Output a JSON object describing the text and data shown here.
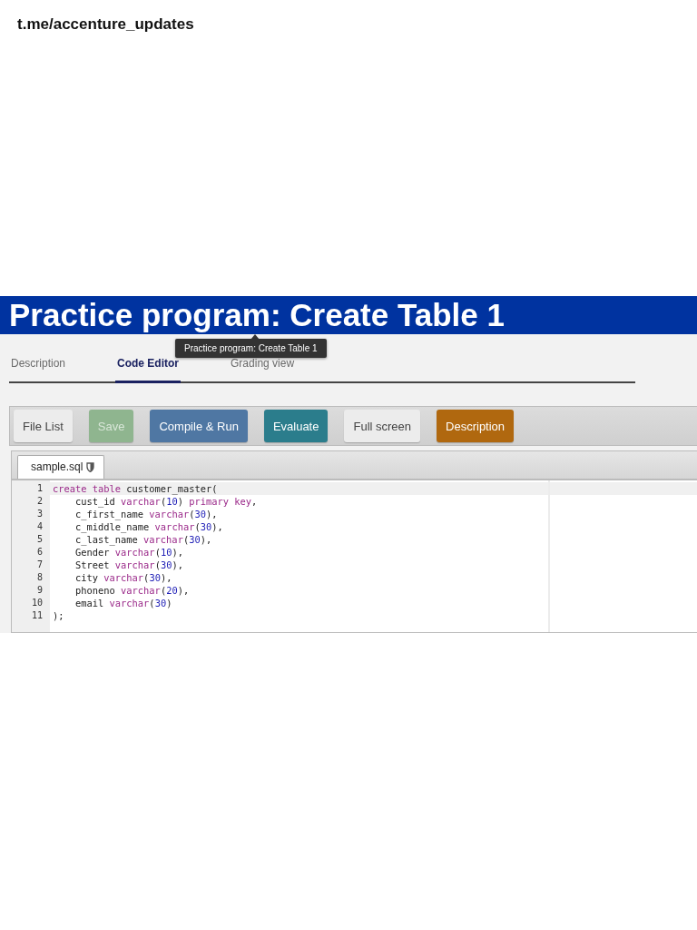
{
  "link": "t.me/accenture_updates",
  "title": "Practice program: Create Table 1",
  "tabs": [
    {
      "label": "Description",
      "selected": false
    },
    {
      "label": "Code Editor",
      "selected": true
    },
    {
      "label": "Grading view",
      "selected": false
    }
  ],
  "tooltip": "Practice program: Create Table 1",
  "toolbar": [
    {
      "label": "File List",
      "color": "#ececec",
      "disabled": false
    },
    {
      "label": "Save",
      "color": "#8fb58f",
      "disabled": true
    },
    {
      "label": "Compile & Run",
      "color": "#4f77a3",
      "disabled": false
    },
    {
      "label": "Evaluate",
      "color": "#2b7d8c",
      "disabled": false
    },
    {
      "label": "Full screen",
      "color": "#ececec",
      "disabled": false
    },
    {
      "label": "Description",
      "color": "#b0680f",
      "disabled": false
    }
  ],
  "file_tab": {
    "label": "sample.sql",
    "selected": true
  },
  "code": [
    {
      "number": "1",
      "active": true,
      "tokens": [
        {
          "kind": "keyword",
          "text": "create table"
        },
        {
          "kind": "plain",
          "text": " customer_master("
        }
      ]
    },
    {
      "number": "2",
      "active": false,
      "tokens": [
        {
          "kind": "plain",
          "text": "    cust_id "
        },
        {
          "kind": "keyword",
          "text": "varchar"
        },
        {
          "kind": "plain",
          "text": "("
        },
        {
          "kind": "number",
          "text": "10"
        },
        {
          "kind": "plain",
          "text": ") "
        },
        {
          "kind": "keyword",
          "text": "primary key"
        },
        {
          "kind": "plain",
          "text": ","
        }
      ]
    },
    {
      "number": "3",
      "active": false,
      "tokens": [
        {
          "kind": "plain",
          "text": "    c_first_name "
        },
        {
          "kind": "keyword",
          "text": "varchar"
        },
        {
          "kind": "plain",
          "text": "("
        },
        {
          "kind": "number",
          "text": "30"
        },
        {
          "kind": "plain",
          "text": "),"
        }
      ]
    },
    {
      "number": "4",
      "active": false,
      "tokens": [
        {
          "kind": "plain",
          "text": "    c_middle_name "
        },
        {
          "kind": "keyword",
          "text": "varchar"
        },
        {
          "kind": "plain",
          "text": "("
        },
        {
          "kind": "number",
          "text": "30"
        },
        {
          "kind": "plain",
          "text": "),"
        }
      ]
    },
    {
      "number": "5",
      "active": false,
      "tokens": [
        {
          "kind": "plain",
          "text": "    c_last_name "
        },
        {
          "kind": "keyword",
          "text": "varchar"
        },
        {
          "kind": "plain",
          "text": "("
        },
        {
          "kind": "number",
          "text": "30"
        },
        {
          "kind": "plain",
          "text": "),"
        }
      ]
    },
    {
      "number": "6",
      "active": false,
      "tokens": [
        {
          "kind": "plain",
          "text": "    Gender "
        },
        {
          "kind": "keyword",
          "text": "varchar"
        },
        {
          "kind": "plain",
          "text": "("
        },
        {
          "kind": "number",
          "text": "10"
        },
        {
          "kind": "plain",
          "text": "),"
        }
      ]
    },
    {
      "number": "7",
      "active": false,
      "tokens": [
        {
          "kind": "plain",
          "text": "    Street "
        },
        {
          "kind": "keyword",
          "text": "varchar"
        },
        {
          "kind": "plain",
          "text": "("
        },
        {
          "kind": "number",
          "text": "30"
        },
        {
          "kind": "plain",
          "text": "),"
        }
      ]
    },
    {
      "number": "8",
      "active": false,
      "tokens": [
        {
          "kind": "plain",
          "text": "    city "
        },
        {
          "kind": "keyword",
          "text": "varchar"
        },
        {
          "kind": "plain",
          "text": "("
        },
        {
          "kind": "number",
          "text": "30"
        },
        {
          "kind": "plain",
          "text": "),"
        }
      ]
    },
    {
      "number": "9",
      "active": false,
      "tokens": [
        {
          "kind": "plain",
          "text": "    phoneno "
        },
        {
          "kind": "keyword",
          "text": "varchar"
        },
        {
          "kind": "plain",
          "text": "("
        },
        {
          "kind": "number",
          "text": "20"
        },
        {
          "kind": "plain",
          "text": "),"
        }
      ]
    },
    {
      "number": "10",
      "active": false,
      "tokens": [
        {
          "kind": "plain",
          "text": "    email "
        },
        {
          "kind": "keyword",
          "text": "varchar"
        },
        {
          "kind": "plain",
          "text": "("
        },
        {
          "kind": "number",
          "text": "30"
        },
        {
          "kind": "plain",
          "text": ")"
        }
      ]
    },
    {
      "number": "11",
      "active": false,
      "tokens": [
        {
          "kind": "plain",
          "text": ");"
        }
      ]
    }
  ]
}
